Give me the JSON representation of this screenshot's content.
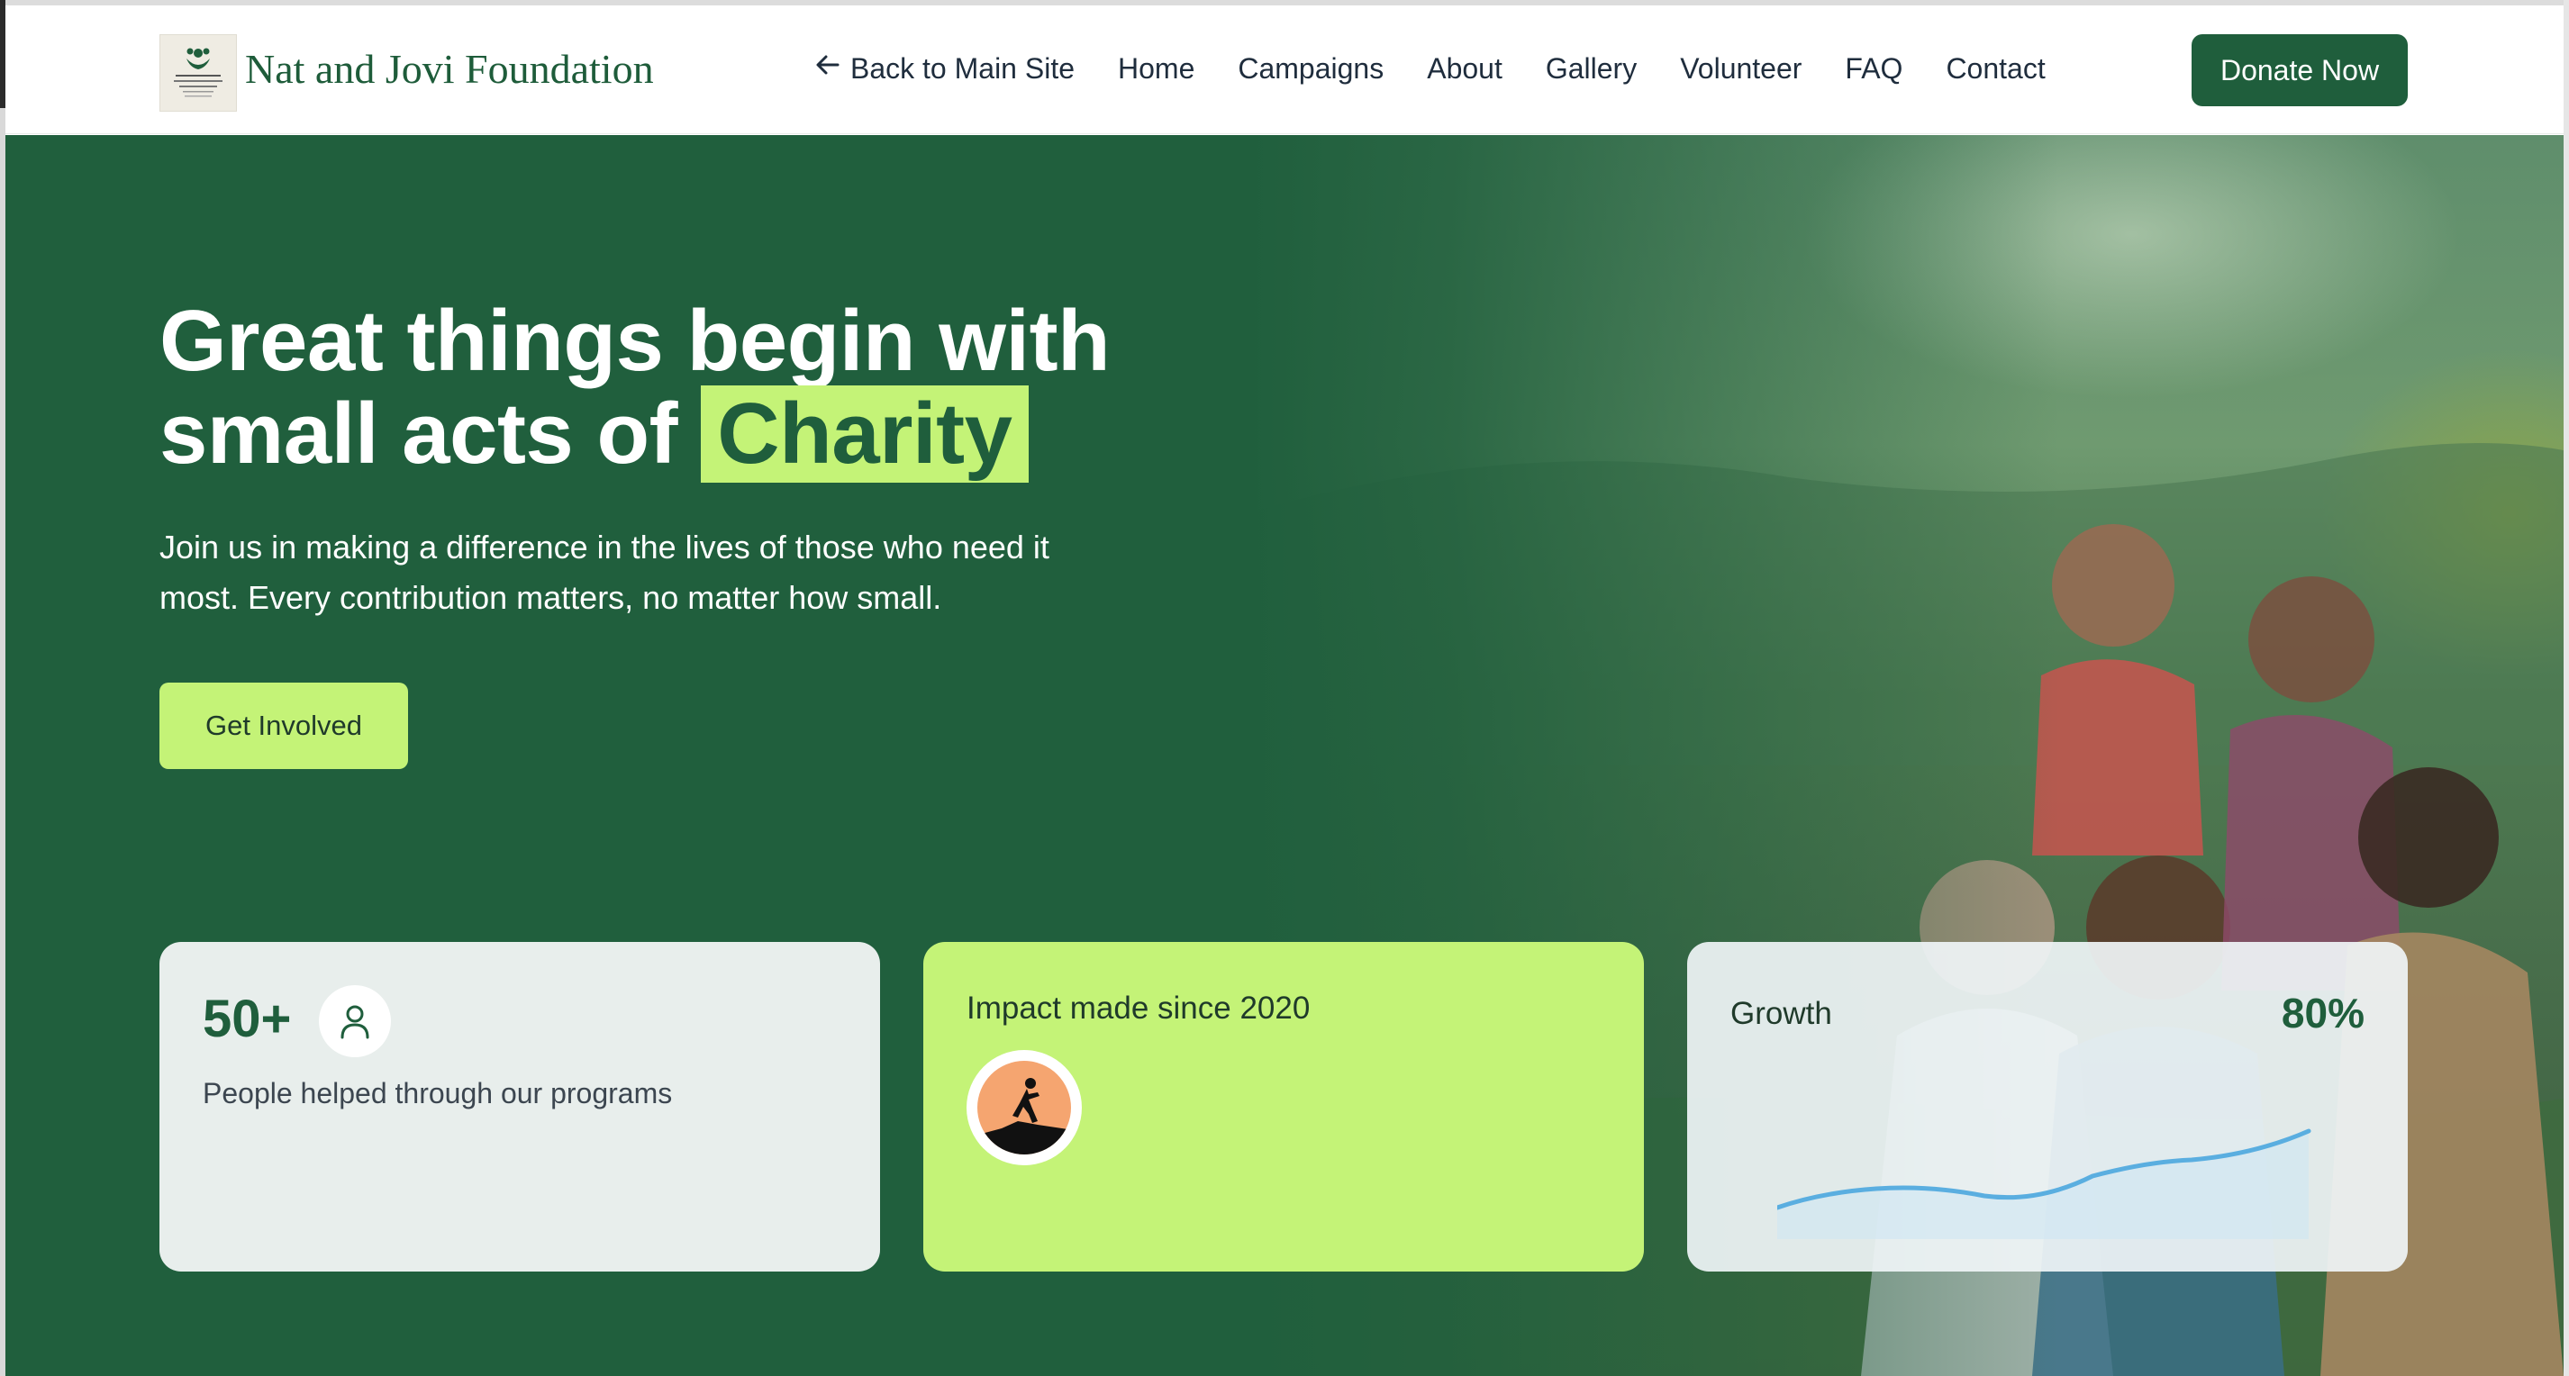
{
  "brand": {
    "name": "Nat and Jovi Foundation"
  },
  "nav": {
    "back": "Back to Main Site",
    "items": [
      "Home",
      "Campaigns",
      "About",
      "Gallery",
      "Volunteer",
      "FAQ",
      "Contact"
    ],
    "donate": "Donate Now"
  },
  "hero": {
    "title_line1": "Great things begin with",
    "title_line2_prefix": "small acts of",
    "title_highlight": "Charity",
    "subtitle_line1": "Join us in making a difference in the lives of those who need it",
    "subtitle_line2": "most. Every contribution matters, no matter how small.",
    "cta": "Get Involved"
  },
  "cards": {
    "people": {
      "value": "50+",
      "label": "People helped through our programs",
      "icon": "user-icon"
    },
    "impact": {
      "title": "Impact made since 2020",
      "icon": "climber-icon"
    },
    "growth": {
      "label": "Growth",
      "value": "80%",
      "icon": "trend-line"
    }
  },
  "colors": {
    "primary": "#1f5e3c",
    "accent": "#c4f377",
    "card_light": "#e8eeec",
    "chart_line": "#5aaee0"
  }
}
